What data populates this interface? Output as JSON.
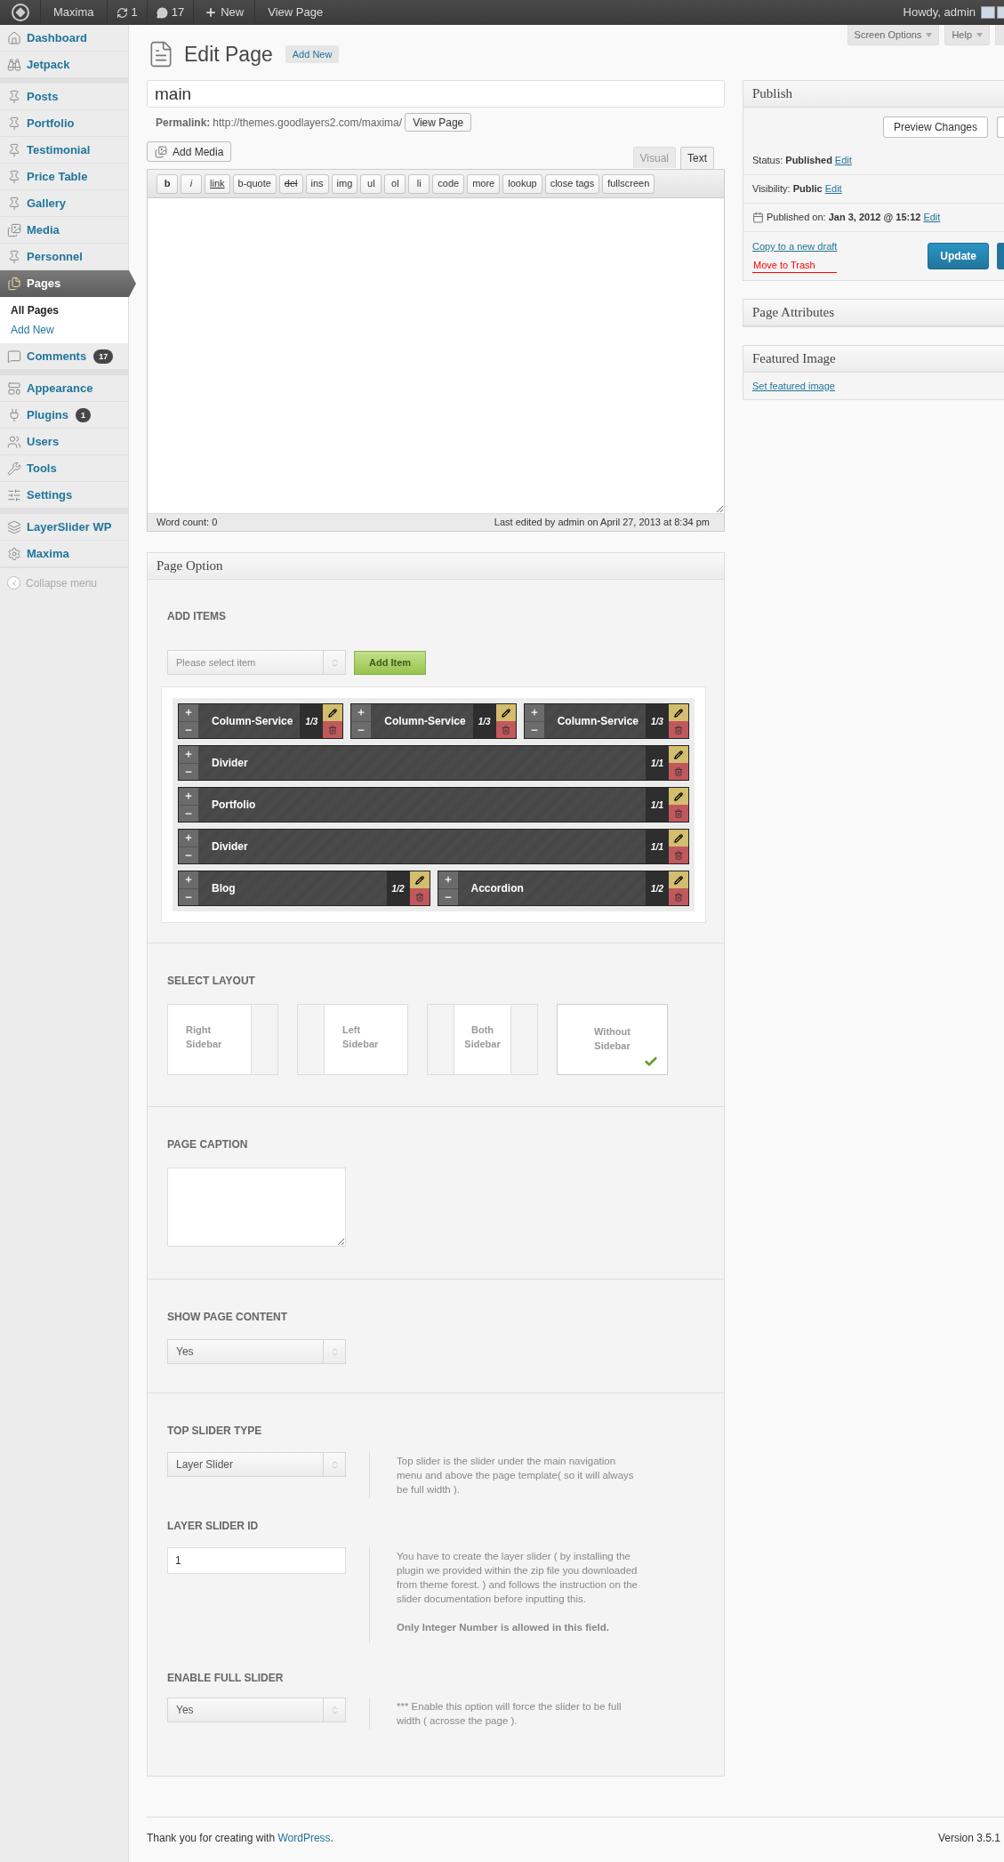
{
  "admin_bar": {
    "site": "Maxima",
    "updates": "1",
    "comments": "17",
    "new_label": "New",
    "view_label": "View Page",
    "greeting": "Howdy, admin"
  },
  "sidebar": {
    "groups": [
      [
        {
          "label": "Dashboard",
          "selected": false
        },
        {
          "label": "Jetpack",
          "selected": false
        }
      ],
      [
        {
          "label": "Posts",
          "selected": false
        },
        {
          "label": "Portfolio",
          "selected": false
        },
        {
          "label": "Testimonial",
          "selected": false
        },
        {
          "label": "Price Table",
          "selected": false
        },
        {
          "label": "Gallery",
          "selected": false
        },
        {
          "label": "Media",
          "selected": false
        },
        {
          "label": "Personnel",
          "selected": false
        },
        {
          "label": "Pages",
          "selected": true,
          "children": [
            {
              "label": "All Pages",
              "selected": true
            },
            {
              "label": "Add New",
              "selected": false
            }
          ]
        },
        {
          "label": "Comments",
          "selected": false,
          "badge": "17"
        }
      ],
      [
        {
          "label": "Appearance",
          "selected": false
        },
        {
          "label": "Plugins",
          "selected": false,
          "badge": "1"
        },
        {
          "label": "Users",
          "selected": false
        },
        {
          "label": "Tools",
          "selected": false
        },
        {
          "label": "Settings",
          "selected": false
        }
      ],
      [
        {
          "label": "LayerSlider WP",
          "selected": false
        },
        {
          "label": "Maxima",
          "selected": false
        }
      ]
    ],
    "collapse": "Collapse menu"
  },
  "header": {
    "title": "Edit Page",
    "add_new": "Add New",
    "screen_options": "Screen Options",
    "help": "Help"
  },
  "post_title": "main",
  "permalink": {
    "label": "Permalink:",
    "url": "http://themes.goodlayers2.com/maxima/",
    "button": "View Page"
  },
  "add_media": "Add Media",
  "editor_tabs": [
    {
      "label": "Visual",
      "selected": false
    },
    {
      "label": "Text",
      "selected": true
    }
  ],
  "quicktags": [
    {
      "label": "b",
      "kind": "bold"
    },
    {
      "label": "i",
      "kind": "italic"
    },
    {
      "label": "link",
      "kind": "underline"
    },
    {
      "label": "b-quote",
      "kind": "plain"
    },
    {
      "label": "del",
      "kind": "strike"
    },
    {
      "label": "ins",
      "kind": "plain"
    },
    {
      "label": "img",
      "kind": "plain"
    },
    {
      "label": "ul",
      "kind": "plain"
    },
    {
      "label": "ol",
      "kind": "plain"
    },
    {
      "label": "li",
      "kind": "plain"
    },
    {
      "label": "code",
      "kind": "plain"
    },
    {
      "label": "more",
      "kind": "plain"
    },
    {
      "label": "lookup",
      "kind": "plain"
    },
    {
      "label": "close tags",
      "kind": "plain"
    },
    {
      "label": "fullscreen",
      "kind": "plain"
    }
  ],
  "word_count": "Word count: 0",
  "last_edited": "Last edited by admin on April 27, 2013 at 8:34 pm",
  "page_option": {
    "title": "Page Option",
    "add_items": {
      "heading": "ADD ITEMS",
      "select_placeholder": "Please select item",
      "button": "Add Item",
      "rows": [
        [
          {
            "name": "Column-Service",
            "size": "1/3"
          },
          {
            "name": "Column-Service",
            "size": "1/3"
          },
          {
            "name": "Column-Service",
            "size": "1/3"
          }
        ],
        [
          {
            "name": "Divider",
            "size": "1/1"
          }
        ],
        [
          {
            "name": "Portfolio",
            "size": "1/1"
          }
        ],
        [
          {
            "name": "Divider",
            "size": "1/1"
          }
        ],
        [
          {
            "name": "Blog",
            "size": "1/2"
          },
          {
            "name": "Accordion",
            "size": "1/2"
          }
        ]
      ]
    },
    "layout": {
      "heading": "SELECT LAYOUT",
      "options": [
        {
          "label": "Right Sidebar",
          "kind": "right",
          "selected": false
        },
        {
          "label": "Left Sidebar",
          "kind": "left",
          "selected": false
        },
        {
          "label": "Both Sidebar",
          "kind": "both",
          "selected": false
        },
        {
          "label": "Without Sidebar",
          "kind": "none",
          "selected": true
        }
      ]
    },
    "caption": {
      "heading": "PAGE CAPTION"
    },
    "show_content": {
      "heading": "SHOW PAGE CONTENT",
      "value": "Yes"
    },
    "top_slider": {
      "heading": "TOP SLIDER TYPE",
      "value": "Layer Slider",
      "help": "Top slider is the slider under the main navigation menu and above the page template( so it will always be full width )."
    },
    "slider_id": {
      "heading": "LAYER SLIDER ID",
      "value": "1",
      "help": "You have to create the layer slider ( by installing the plugin we provided within the zip file you downloaded from theme forest. ) and follows the instruction on the slider documentation before inputting this.",
      "note": "Only Integer Number is allowed in this field."
    },
    "full_slider": {
      "heading": "ENABLE FULL SLIDER",
      "value": "Yes",
      "help": "*** Enable this option will force the slider to be full width ( acrosse the page )."
    }
  },
  "publish": {
    "title": "Publish",
    "preview": "Preview Changes",
    "status": "Status: **Published**",
    "visibility": "Visibility: **Public**",
    "published_on": "Published on: **Jan 3, 2012 @ 15:12**",
    "status_edit": "Edit",
    "visibility_edit": "Edit",
    "date_edit": "Edit",
    "copy": "Copy to a new draft",
    "trash": "Move to Trash",
    "update": "Update"
  },
  "page_attributes": {
    "title": "Page Attributes"
  },
  "featured_image": {
    "title": "Featured Image",
    "link": "Set featured image"
  },
  "footer": {
    "text": "Thank you for creating with",
    "link": "WordPress",
    "after": ".",
    "version": "Version 3.5.1"
  }
}
